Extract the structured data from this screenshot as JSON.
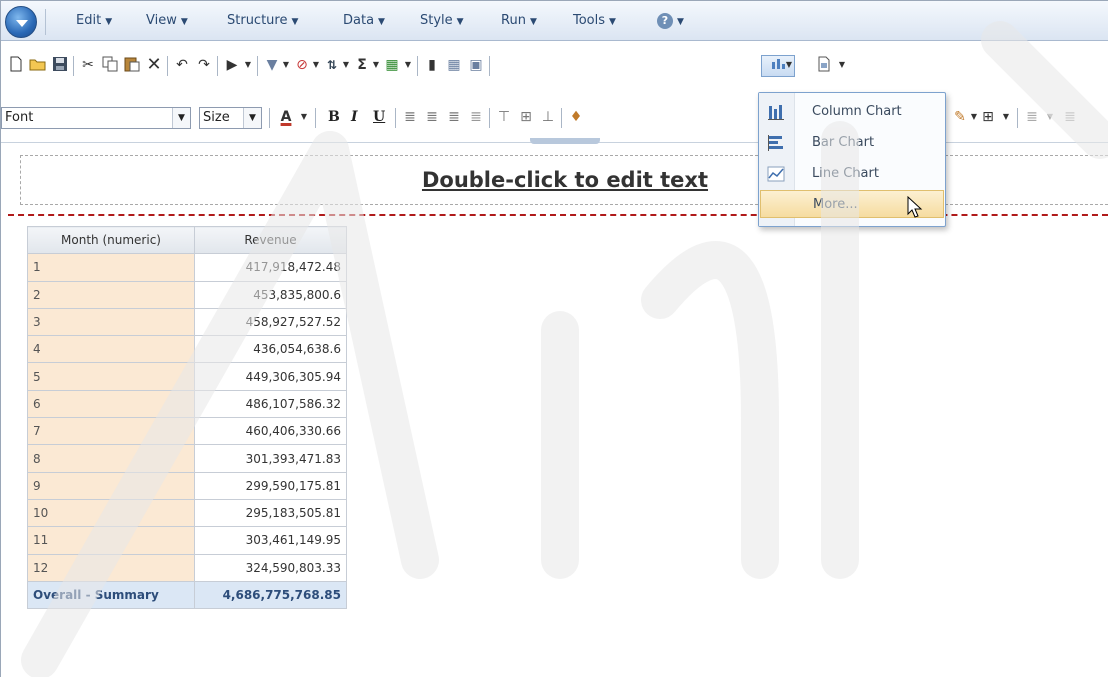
{
  "menubar": {
    "items": [
      {
        "label": "Edit"
      },
      {
        "label": "View"
      },
      {
        "label": "Structure"
      },
      {
        "label": "Data"
      },
      {
        "label": "Style"
      },
      {
        "label": "Run"
      },
      {
        "label": "Tools"
      }
    ],
    "help_glyph": "?"
  },
  "format_toolbar": {
    "font_value": "Font",
    "size_value": "Size"
  },
  "report": {
    "title_placeholder": "Double-click to edit text",
    "table": {
      "headers": [
        "Month (numeric)",
        "Revenue"
      ],
      "rows": [
        {
          "month": "1",
          "revenue": "417,918,472.48"
        },
        {
          "month": "2",
          "revenue": "453,835,800.6"
        },
        {
          "month": "3",
          "revenue": "458,927,527.52"
        },
        {
          "month": "4",
          "revenue": "436,054,638.6"
        },
        {
          "month": "5",
          "revenue": "449,306,305.94"
        },
        {
          "month": "6",
          "revenue": "486,107,586.32"
        },
        {
          "month": "7",
          "revenue": "460,406,330.66"
        },
        {
          "month": "8",
          "revenue": "301,393,471.83"
        },
        {
          "month": "9",
          "revenue": "299,590,175.81"
        },
        {
          "month": "10",
          "revenue": "295,183,505.81"
        },
        {
          "month": "11",
          "revenue": "303,461,149.95"
        },
        {
          "month": "12",
          "revenue": "324,590,803.33"
        }
      ],
      "summary": {
        "label": "Overall - Summary",
        "value": "4,686,775,768.85"
      }
    }
  },
  "chart_menu": {
    "items": [
      {
        "label": "Column Chart",
        "icon": "column-chart-icon"
      },
      {
        "label": "Bar Chart",
        "icon": "bar-chart-icon"
      },
      {
        "label": "Line Chart",
        "icon": "line-chart-icon"
      },
      {
        "label": "More...",
        "icon": ""
      }
    ],
    "highlighted_item": "More..."
  },
  "colors": {
    "accent": "#2a69b6",
    "summary_row": "#dbe7f5",
    "month_cells": "#fbe9d4",
    "drop_line": "#b01a1a",
    "menu_highlight": "#f6dca0"
  }
}
